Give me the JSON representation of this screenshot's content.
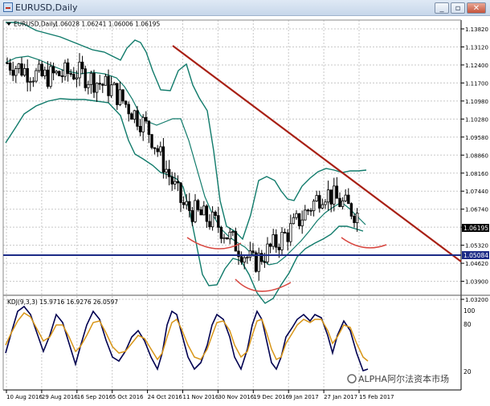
{
  "window": {
    "title": "EURUSD,Daily",
    "buttons": {
      "minimize": "_",
      "restore": "▫",
      "close": "✕"
    }
  },
  "chart_header": {
    "symbol": "EURUSD,Daily",
    "ohlc": "1.06028 1.06241 1.06006 1.06195"
  },
  "indicator": {
    "label": "KDJ(9,3,3) 15.9716 16.9276 26.0597",
    "levels": [
      "100",
      "80",
      "20"
    ]
  },
  "price_axis": [
    "1.13820",
    "1.13120",
    "1.12400",
    "1.11700",
    "1.10980",
    "1.10280",
    "1.09580",
    "1.08860",
    "1.08160",
    "1.07440",
    "1.06740",
    "1.06020",
    "1.05320",
    "1.04620",
    "1.03900",
    "1.03200"
  ],
  "current_price": "1.06195",
  "support_level": "1.05084",
  "date_axis": [
    "10 Aug 2016",
    "29 Aug 2016",
    "16 Sep 2016",
    "5 Oct 2016",
    "24 Oct 2016",
    "11 Nov 2016",
    "30 Nov 2016",
    "19 Dec 2016",
    "9 Jan 2017",
    "27 Jan 2017",
    "15 Feb 2017"
  ],
  "watermark": "ALPHA阿尔法资本市场",
  "colors": {
    "candles": "#000000",
    "bollinger": "#0f7a6a",
    "trendline": "#a82015",
    "support": "#1b2a86",
    "annotation": "#d8463f",
    "k_line": "#000050",
    "d_line": "#d89618"
  },
  "chart_data": {
    "type": "line",
    "x": [
      "10 Aug 2016",
      "29 Aug 2016",
      "16 Sep 2016",
      "5 Oct 2016",
      "24 Oct 2016",
      "11 Nov 2016",
      "30 Nov 2016",
      "19 Dec 2016",
      "9 Jan 2017",
      "27 Jan 2017",
      "15 Feb 2017"
    ],
    "series": [
      {
        "name": "EURUSD",
        "values": [
          1.125,
          1.119,
          1.121,
          1.114,
          1.098,
          1.066,
          1.058,
          1.042,
          1.055,
          1.072,
          1.062
        ]
      }
    ],
    "ylim": [
      1.029,
      1.1425
    ],
    "grid": true,
    "title": "EURUSD,Daily"
  }
}
